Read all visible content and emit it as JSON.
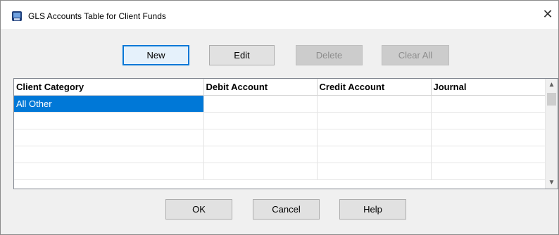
{
  "window": {
    "title": "GLS Accounts Table for Client Funds",
    "close_glyph": "✕"
  },
  "toolbar": {
    "new_label": "New",
    "edit_label": "Edit",
    "delete_label": "Delete",
    "clear_all_label": "Clear All"
  },
  "table": {
    "columns": [
      "Client Category",
      "Debit Account",
      "Credit Account",
      "Journal"
    ],
    "rows": [
      [
        "All Other",
        "",
        "",
        ""
      ],
      [
        "",
        "",
        "",
        ""
      ],
      [
        "",
        "",
        "",
        ""
      ],
      [
        "",
        "",
        "",
        ""
      ],
      [
        "",
        "",
        "",
        ""
      ]
    ],
    "selected_row": 0
  },
  "footer": {
    "ok_label": "OK",
    "cancel_label": "Cancel",
    "help_label": "Help"
  },
  "colors": {
    "accent": "#0078d7"
  },
  "icons": {
    "app": "app-icon",
    "close": "close-icon",
    "scroll_up": "chevron-up-icon",
    "scroll_down": "chevron-down-icon"
  }
}
